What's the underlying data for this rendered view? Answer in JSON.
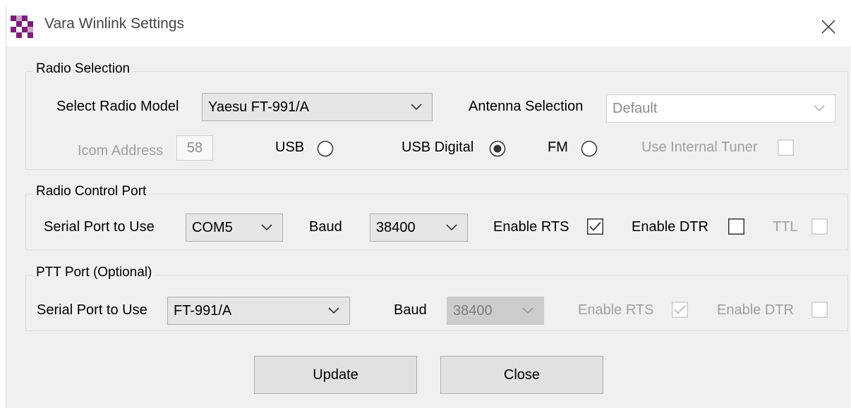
{
  "window": {
    "title": "Vara Winlink Settings"
  },
  "radio_selection": {
    "group_title": "Radio Selection",
    "model_label": "Select Radio Model",
    "model_value": "Yaesu FT-991/A",
    "antenna_label": "Antenna Selection",
    "antenna_value": "Default",
    "icom_address_label": "Icom Address",
    "icom_address_value": "58",
    "modes": [
      {
        "label": "USB",
        "selected": false
      },
      {
        "label": "USB Digital",
        "selected": true
      },
      {
        "label": "FM",
        "selected": false
      }
    ],
    "internal_tuner_label": "Use Internal Tuner",
    "internal_tuner_checked": false
  },
  "radio_control_port": {
    "group_title": "Radio Control Port",
    "serial_label": "Serial Port to Use",
    "serial_value": "COM5",
    "baud_label": "Baud",
    "baud_value": "38400",
    "rts_label": "Enable RTS",
    "rts_checked": true,
    "dtr_label": "Enable DTR",
    "dtr_checked": false,
    "ttl_label": "TTL",
    "ttl_checked": false
  },
  "ptt_port": {
    "group_title": "PTT Port (Optional)",
    "serial_label": "Serial Port to Use",
    "serial_value": "FT-991/A",
    "baud_label": "Baud",
    "baud_value": "38400",
    "rts_label": "Enable RTS",
    "rts_checked": true,
    "dtr_label": "Enable DTR",
    "dtr_checked": false
  },
  "buttons": {
    "update_label": "Update",
    "close_label": "Close"
  }
}
